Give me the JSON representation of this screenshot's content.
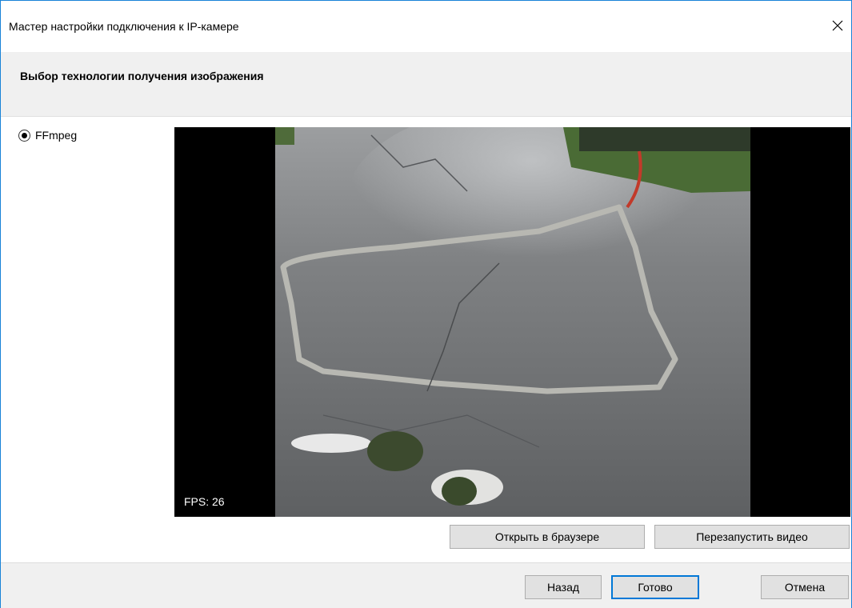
{
  "window": {
    "title": "Мастер настройки подключения к IP-камере"
  },
  "header": {
    "title": "Выбор технологии получения изображения"
  },
  "source_options": [
    {
      "label": "FFmpeg",
      "selected": true
    }
  ],
  "video": {
    "fps_label": "FPS: 26"
  },
  "video_buttons": {
    "open_in_browser": "Открыть в браузере",
    "restart_video": "Перезапустить видео"
  },
  "footer": {
    "back": "Назад",
    "done": "Готово",
    "cancel": "Отмена"
  },
  "colors": {
    "accent": "#0078d7",
    "window_border": "#1883d7"
  },
  "icons": {
    "close": "close-icon",
    "radio": "radio-selected-icon"
  }
}
